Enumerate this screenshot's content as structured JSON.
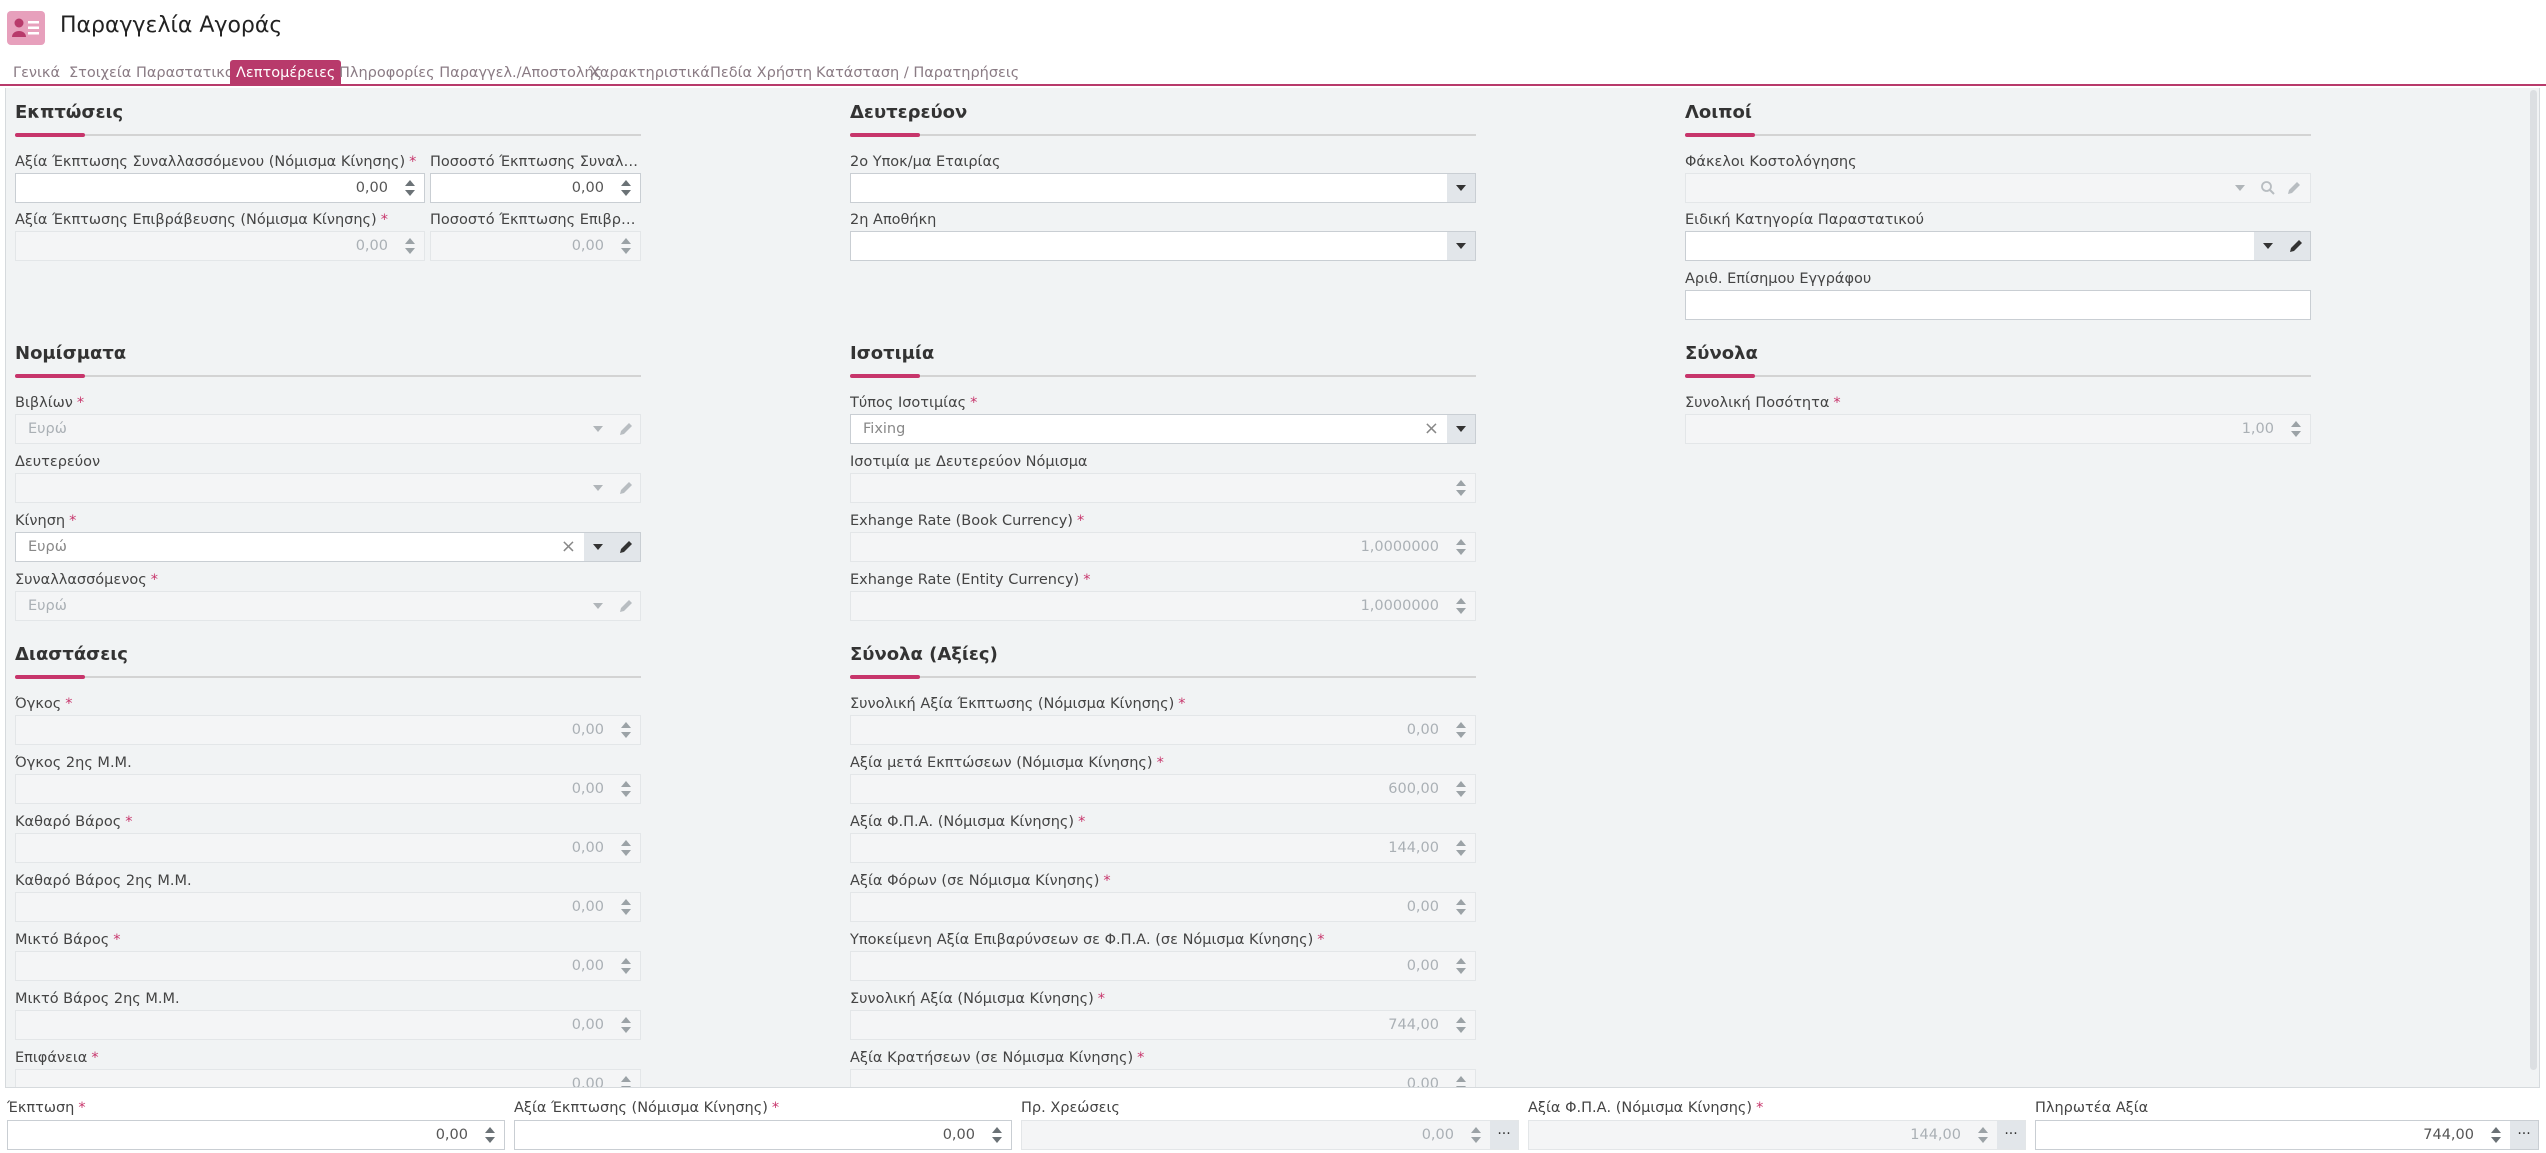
{
  "header": {
    "title": "Παραγγελία Αγοράς",
    "icon": "contact-card-icon"
  },
  "tabs": [
    {
      "label": "Γενικά"
    },
    {
      "label": "Στοιχεία Παραστατικού"
    },
    {
      "label": "Λεπτομέρειες",
      "active": true
    },
    {
      "label": "Πληροφορίες Παραγγελ./Αποστολής"
    },
    {
      "label": "Χαρακτηριστικά"
    },
    {
      "label": "Πεδία Χρήστη"
    },
    {
      "label": "Κατάσταση / Παρατηρήσεις"
    }
  ],
  "discounts": {
    "title": "Εκπτώσεις",
    "counterparty_discount_label": "Αξία Έκπτωσης Συναλλασσόμενου (Νόμισμα Κίνησης)",
    "counterparty_discount_value": "0,00",
    "counterparty_pct_label": "Ποσοστό Έκπτωσης Συναλλα...",
    "counterparty_pct_value": "0,00",
    "reward_discount_label": "Αξία Έκπτωσης Επιβράβευσης (Νόμισμα Κίνησης)",
    "reward_discount_value": "0,00",
    "reward_pct_label": "Ποσοστό Έκπτωσης Επιβράβ...",
    "reward_pct_value": "0,00"
  },
  "secondary": {
    "title": "Δευτερεύον",
    "company_branch_label": "2ο Υποκ/μα Εταιρίας",
    "company_branch_value": "",
    "warehouse_label": "2η Αποθήκη",
    "warehouse_value": ""
  },
  "other": {
    "title": "Λοιποί",
    "costing_folders_label": "Φάκελοι Κοστολόγησης",
    "special_category_label": "Ειδική Κατηγορία Παραστατικού",
    "official_doc_number_label": "Αριθ. Επίσημου Εγγράφου"
  },
  "currencies": {
    "title": "Νομίσματα",
    "books_label": "Βιβλίων",
    "books_value": "Ευρώ",
    "secondary_label": "Δευτερεύον",
    "secondary_value": "",
    "movement_label": "Κίνηση",
    "movement_value": "Ευρώ",
    "counterparty_label": "Συναλλασσόμενος",
    "counterparty_value": "Ευρώ"
  },
  "exchange": {
    "title": "Ισοτιμία",
    "type_label": "Τύπος Ισοτιμίας",
    "type_value": "Fixing",
    "secondary_rate_label": "Ισοτιμία με Δευτερεύον Νόμισμα",
    "secondary_rate_value": "",
    "book_rate_label": "Exhange Rate (Book Currency)",
    "book_rate_value": "1,0000000",
    "entity_rate_label": "Exhange Rate (Entity Currency)",
    "entity_rate_value": "1,0000000"
  },
  "totals": {
    "title": "Σύνολα",
    "total_qty_label": "Συνολική Ποσότητα",
    "total_qty_value": "1,00"
  },
  "dimensions": {
    "title": "Διαστάσεις",
    "items": [
      {
        "label": "Όγκος",
        "required": true,
        "value": "0,00"
      },
      {
        "label": "Όγκος 2ης Μ.Μ.",
        "required": false,
        "value": "0,00"
      },
      {
        "label": "Καθαρό Βάρος",
        "required": true,
        "value": "0,00"
      },
      {
        "label": "Καθαρό Βάρος 2ης Μ.Μ.",
        "required": false,
        "value": "0,00"
      },
      {
        "label": "Μικτό Βάρος",
        "required": true,
        "value": "0,00"
      },
      {
        "label": "Μικτό Βάρος 2ης Μ.Μ.",
        "required": false,
        "value": "0,00"
      },
      {
        "label": "Επιφάνεια",
        "required": true,
        "value": "0,00"
      }
    ]
  },
  "value_totals": {
    "title": "Σύνολα (Αξίες)",
    "items": [
      {
        "label": "Συνολική Αξία Έκπτωσης (Νόμισμα Κίνησης)",
        "value": "0,00"
      },
      {
        "label": "Αξία μετά Εκπτώσεων (Νόμισμα Κίνησης)",
        "value": "600,00"
      },
      {
        "label": "Αξία Φ.Π.Α. (Νόμισμα Κίνησης)",
        "value": "144,00"
      },
      {
        "label": "Αξία Φόρων (σε Νόμισμα Κίνησης)",
        "value": "0,00"
      },
      {
        "label": "Υποκείμενη Αξία Επιβαρύνσεων σε Φ.Π.Α. (σε Νόμισμα Κίνησης)",
        "value": "0,00"
      },
      {
        "label": "Συνολική Αξία (Νόμισμα Κίνησης)",
        "value": "744,00"
      },
      {
        "label": "Αξία Κρατήσεων (σε Νόμισμα Κίνησης)",
        "value": "0,00"
      }
    ]
  },
  "footer": {
    "discount_label": "Έκπτωση",
    "discount_value": "0,00",
    "discount_amount_label": "Αξία Έκπτωσης (Νόμισμα Κίνησης)",
    "discount_amount_value": "0,00",
    "pre_charges_label": "Πρ. Χρεώσεις",
    "pre_charges_value": "0,00",
    "vat_label": "Αξία Φ.Π.Α. (Νόμισμα Κίνησης)",
    "vat_value": "144,00",
    "payable_label": "Πληρωτέα Αξία",
    "payable_value": "744,00",
    "more_symbol": "···"
  },
  "colors": {
    "accent": "#b83a6b",
    "required": "#c7356b",
    "background": "#f1f3f4"
  }
}
